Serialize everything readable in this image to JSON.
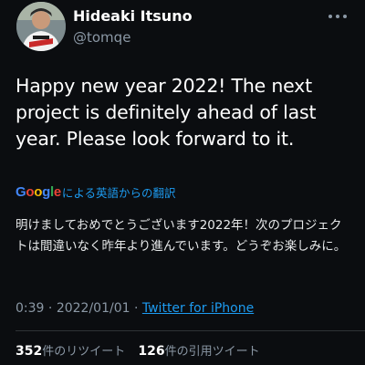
{
  "user": {
    "display_name": "Hideaki Itsuno",
    "handle": "@tomqe"
  },
  "tweet": {
    "text": "Happy new year 2022! The next project is definitely ahead of last year. Please look forward to it.",
    "translate_label": "による英語からの翻訳",
    "translated_text": "明けましておめでとうございます2022年！次のプロジェクトは間違いなく昨年より進んでいます。どうぞお楽しみに。",
    "time": "0:39",
    "date": "2022/01/01",
    "separator": "·",
    "source": "Twitter for iPhone"
  },
  "stats": {
    "retweets_count": "352",
    "retweets_label": "件のリツイート",
    "quotes_count": "126",
    "quotes_label": "件の引用ツイート"
  },
  "icons": {
    "more": "more-horizontal-icon",
    "avatar": "profile-photo",
    "logo": "google-logo"
  },
  "colors": {
    "background": "#0b0d10",
    "link": "#1d9bf0",
    "secondary_text": "#8b98a5"
  }
}
